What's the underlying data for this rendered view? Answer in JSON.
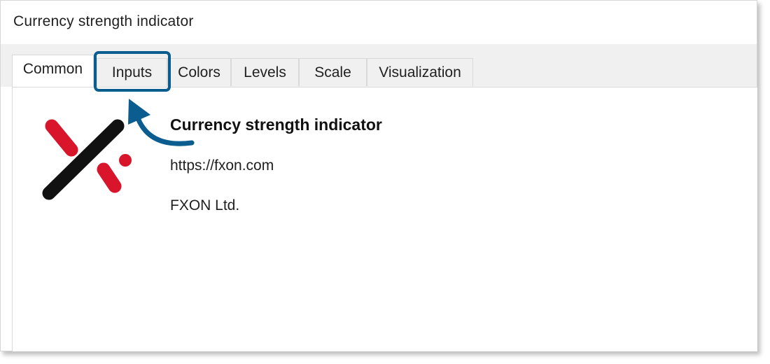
{
  "window": {
    "title": "Currency strength indicator"
  },
  "tabs": [
    {
      "label": "Common",
      "active": true
    },
    {
      "label": "Inputs",
      "active": false,
      "highlighted": true
    },
    {
      "label": "Colors",
      "active": false
    },
    {
      "label": "Levels",
      "active": false
    },
    {
      "label": "Scale",
      "active": false
    },
    {
      "label": "Visualization",
      "active": false
    }
  ],
  "info": {
    "name": "Currency strength indicator",
    "url": "https://fxon.com",
    "company": "FXON Ltd."
  },
  "icons": {
    "logo": "fxon-logo-icon",
    "annotation_arrow": "curved-arrow-icon"
  },
  "colors": {
    "highlight": "#0b5c8f",
    "logo_red": "#d9152b",
    "logo_black": "#111111"
  }
}
